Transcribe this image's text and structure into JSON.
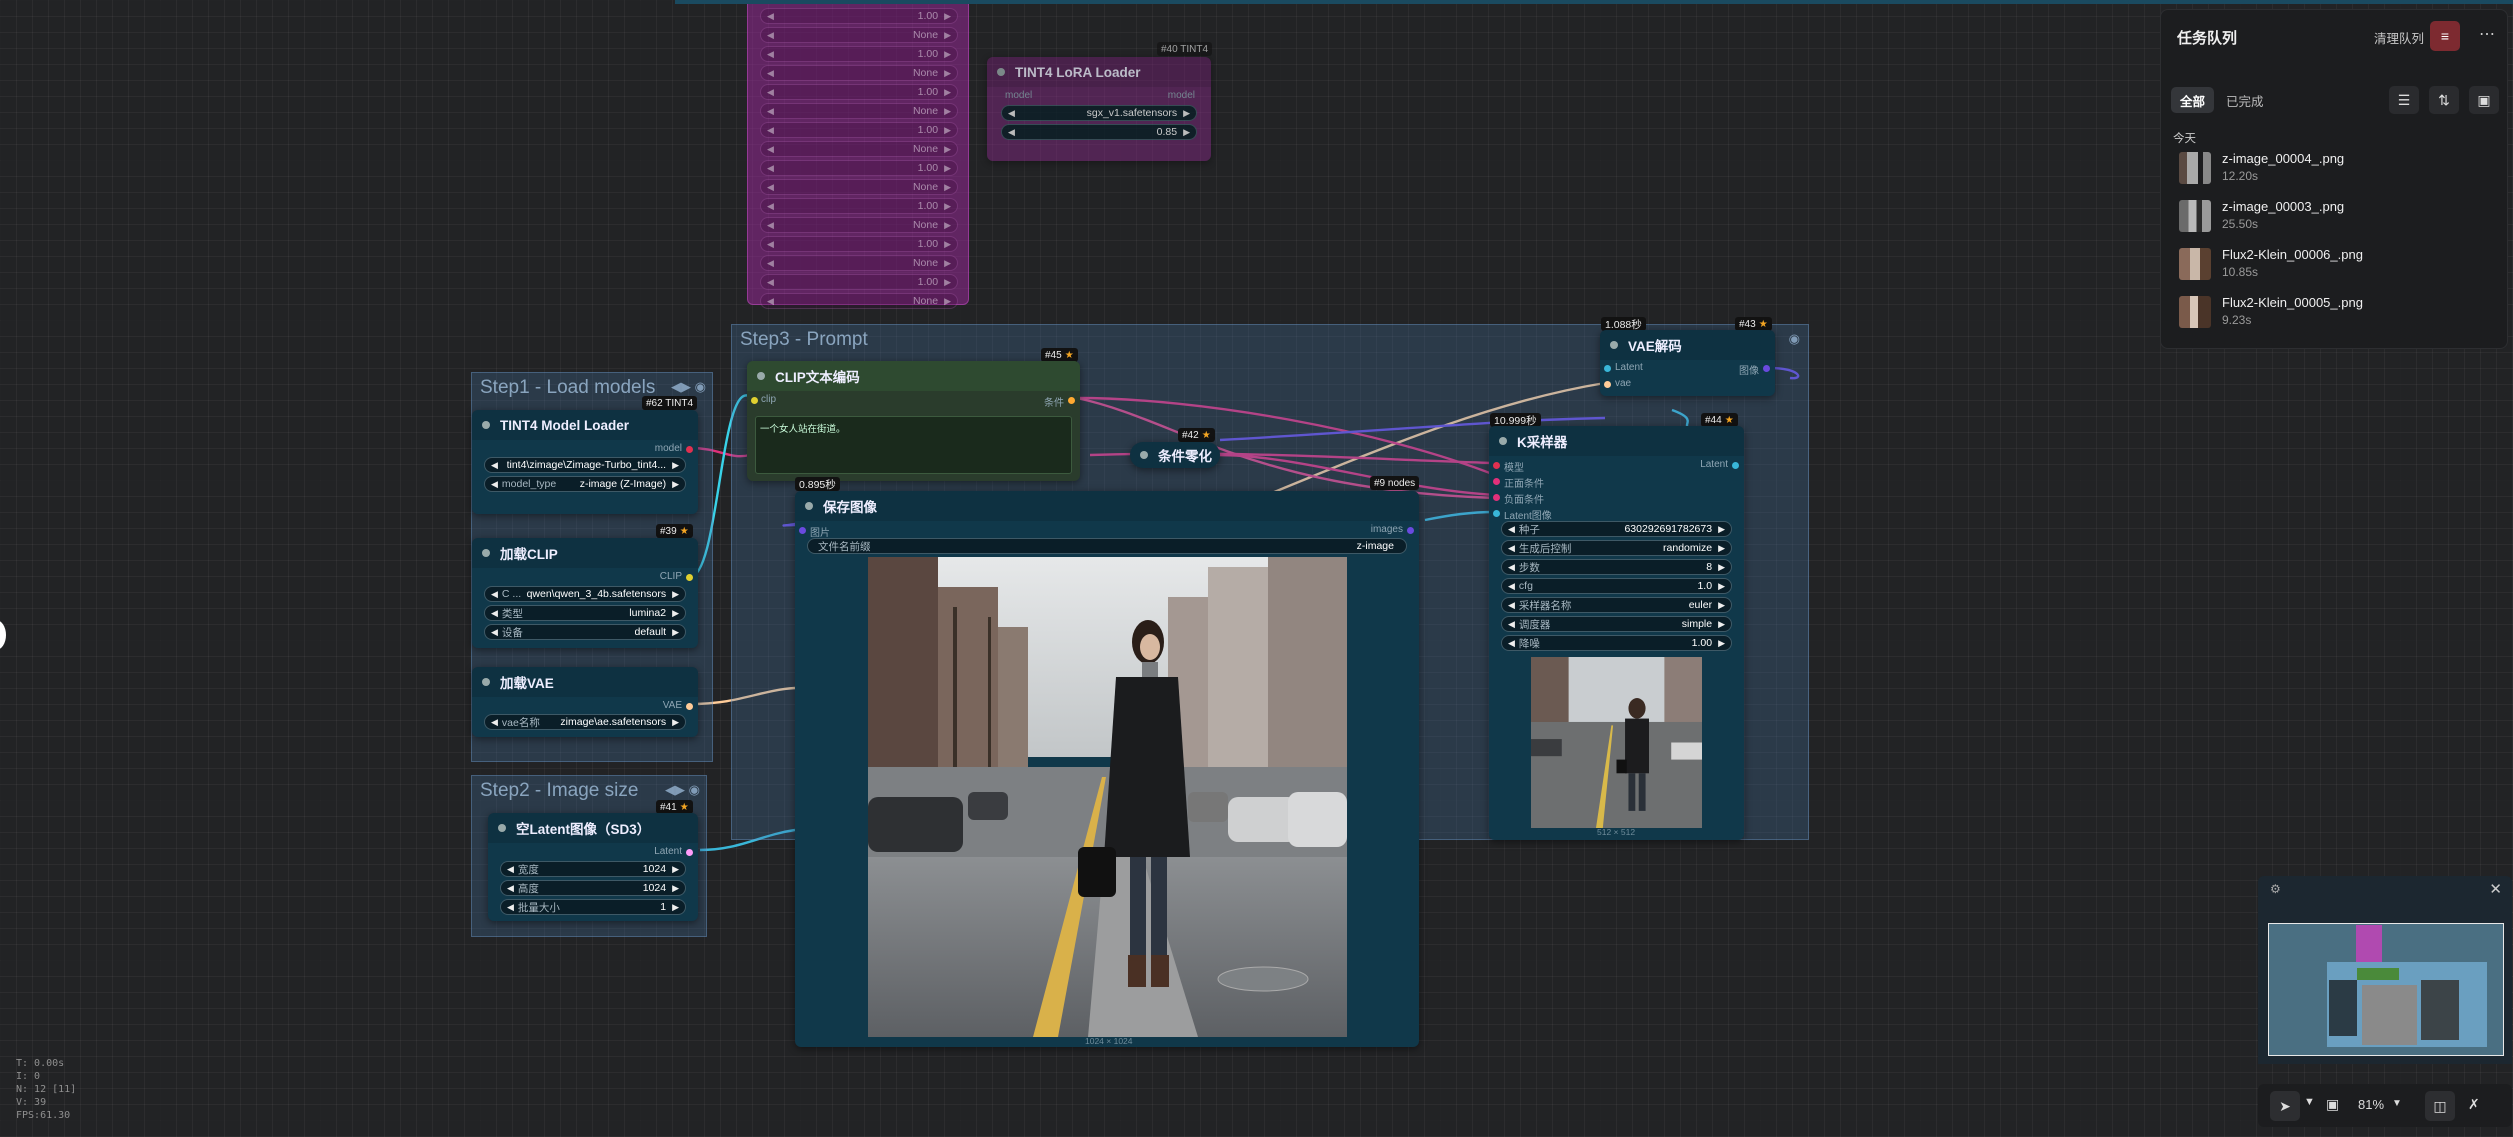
{
  "lora_node": {
    "title": "TINT4 LoRA Loader",
    "input": "model",
    "output": "model",
    "widget_value": "sgx_v1.safetensors",
    "widget_number": "0.85",
    "badge": "#40 TINT4",
    "stack_values": [
      "1.00",
      "None",
      "1.00",
      "None",
      "1.00",
      "None",
      "1.00",
      "None",
      "1.00",
      "None",
      "1.00",
      "None",
      "1.00",
      "None",
      "1.00",
      "None"
    ]
  },
  "group_step1": {
    "title": "Step1 - Load models"
  },
  "group_step2": {
    "title": "Step2 - Image size"
  },
  "group_step3": {
    "title": "Step3 - Prompt"
  },
  "model_loader": {
    "badge": "#62 TINT4",
    "title": "TINT4 Model Loader",
    "output": "model",
    "w1_value": "tint4\\zimage\\Zimage-Turbo_tint4...",
    "w2_label": "model_type",
    "w2_value": "z-image (Z-Image)"
  },
  "clip_loader": {
    "badge": "#39",
    "title": "加载CLIP",
    "output": "CLIP",
    "w1_label": "C ...",
    "w1_value": "qwen\\qwen_3_4b.safetensors",
    "w2_label": "类型",
    "w2_value": "lumina2",
    "w3_label": "设备",
    "w3_value": "default"
  },
  "vae_loader": {
    "title": "加载VAE",
    "output": "VAE",
    "w1_label": "vae名称",
    "w1_value": "zimage\\ae.safetensors"
  },
  "latent_node": {
    "badge": "#41",
    "title": "空Latent图像（SD3）",
    "output": "Latent",
    "w1_label": "宽度",
    "w1_value": "1024",
    "w2_label": "高度",
    "w2_value": "1024",
    "w3_label": "批量大小",
    "w3_value": "1"
  },
  "clip_encode": {
    "badge": "#45",
    "title": "CLIP文本编码",
    "input": "clip",
    "output": "条件",
    "text": "一个女人站在街道。"
  },
  "cond_zero": {
    "badge": "#42",
    "title": "条件零化"
  },
  "nodes_badge": "#9 nodes",
  "save_image": {
    "timer": "0.895秒",
    "title": "保存图像",
    "input": "图片",
    "output": "images",
    "w1_label": "文件名前缀",
    "w1_value": "z-image",
    "size_label": "1024 × 1024"
  },
  "vae_decode": {
    "timer": "1.088秒",
    "badge": "#43",
    "title": "VAE解码",
    "in1": "Latent",
    "in2": "vae",
    "output": "图像"
  },
  "ksampler": {
    "timer": "10.999秒",
    "badge": "#44",
    "title": "K采样器",
    "in1": "模型",
    "in2": "正面条件",
    "in3": "负面条件",
    "in4": "Latent图像",
    "output": "Latent",
    "w1_label": "种子",
    "w1_value": "630292691782673",
    "w2_label": "生成后控制",
    "w2_value": "randomize",
    "w3_label": "步数",
    "w3_value": "8",
    "w4_label": "cfg",
    "w4_value": "1.0",
    "w5_label": "采样器名称",
    "w5_value": "euler",
    "w6_label": "调度器",
    "w6_value": "simple",
    "w7_label": "降噪",
    "w7_value": "1.00",
    "size_label": "512 × 512"
  },
  "queue": {
    "title": "任务队列",
    "clear_label": "清理队列",
    "tab_all": "全部",
    "tab_done": "已完成",
    "section": "今天",
    "items": [
      {
        "name": "z-image_00004_.png",
        "time": "12.20s"
      },
      {
        "name": "z-image_00003_.png",
        "time": "25.50s"
      },
      {
        "name": "Flux2-Klein_00006_.png",
        "time": "10.85s"
      },
      {
        "name": "Flux2-Klein_00005_.png",
        "time": "9.23s"
      }
    ]
  },
  "toolbar": {
    "zoom": "81%"
  },
  "stats": [
    "T: 0.00s",
    "I: 0",
    "N: 12 [11]",
    "V: 39",
    "FPS:61.30"
  ],
  "colors": {
    "accent_red": "#7d2a30",
    "link_pink": "#e0307a",
    "link_cyan": "#39b6d8",
    "link_orange": "#ffcc99"
  }
}
